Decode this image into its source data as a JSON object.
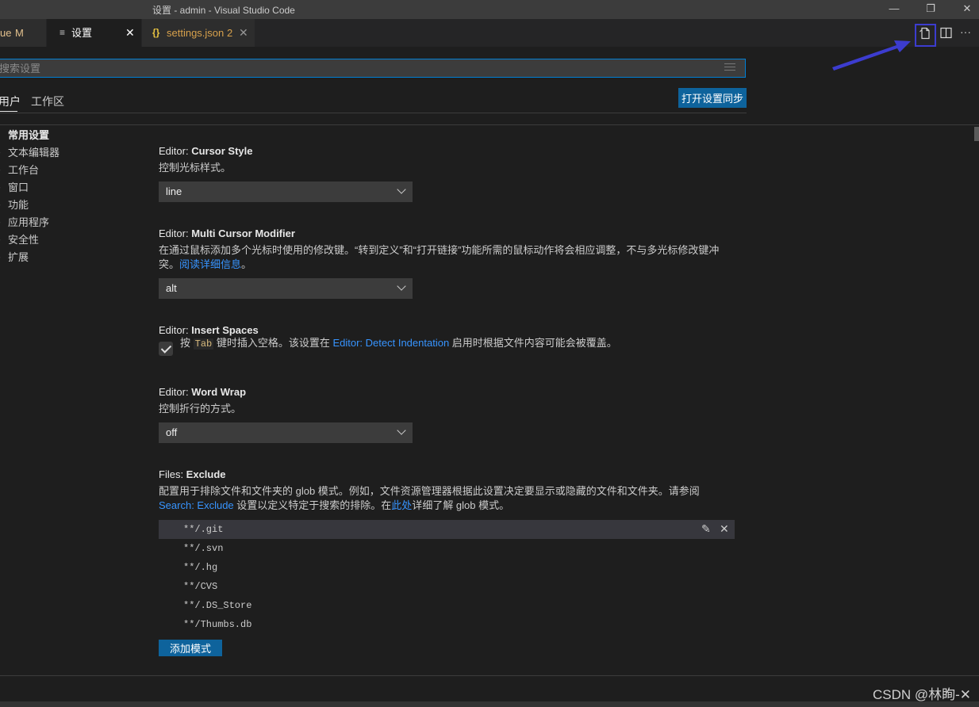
{
  "window": {
    "title": "设置 - admin - Visual Studio Code",
    "minimize_glyph": "—",
    "restore_glyph": "❐",
    "close_glyph": "✕"
  },
  "tabs": [
    {
      "label": "ue",
      "status": "M"
    },
    {
      "label": "设置",
      "icon": "≡",
      "close": "✕"
    },
    {
      "label": "settings.json",
      "icon": "{}",
      "problems": "2",
      "close": "✕"
    }
  ],
  "editor_actions": {
    "open_json_icon": "open-settings-json-icon",
    "split_icon": "split-editor-icon",
    "more_glyph": "···"
  },
  "search": {
    "placeholder": "搜索设置"
  },
  "scopes": {
    "user": "用户",
    "workspace": "工作区",
    "sync_button": "打开设置同步"
  },
  "toc": [
    {
      "label": "常用设置",
      "expandable": false
    },
    {
      "label": "文本编辑器",
      "expandable": true
    },
    {
      "label": "工作台",
      "expandable": true
    },
    {
      "label": "窗口",
      "expandable": true
    },
    {
      "label": "功能",
      "expandable": true
    },
    {
      "label": "应用程序",
      "expandable": true
    },
    {
      "label": "安全性",
      "expandable": true
    },
    {
      "label": "扩展",
      "expandable": true
    }
  ],
  "settings": {
    "cursor_style": {
      "category": "Editor: ",
      "name": "Cursor Style",
      "description": "控制光标样式。",
      "value": "line"
    },
    "multi_cursor": {
      "category": "Editor: ",
      "name": "Multi Cursor Modifier",
      "description": "在通过鼠标添加多个光标时使用的修改键。“转到定义”和“打开链接”功能所需的鼠标动作将会相应调整，不与多光标修改键冲突。",
      "link": "阅读详细信息",
      "suffix": "。",
      "value": "alt"
    },
    "insert_spaces": {
      "category": "Editor: ",
      "name": "Insert Spaces",
      "text_before": "按 ",
      "code": "Tab",
      "text_mid": " 键时插入空格。该设置在 ",
      "link": "Editor: Detect Indentation",
      "text_after": " 启用时根据文件内容可能会被覆盖。",
      "checked": true
    },
    "word_wrap": {
      "category": "Editor: ",
      "name": "Word Wrap",
      "description": "控制折行的方式。",
      "value": "off"
    },
    "files_exclude": {
      "category": "Files: ",
      "name": "Exclude",
      "desc_line1": "配置用于排除文件和文件夹的 glob 模式。例如，文件资源管理器根据此设置决定要显示或隐藏的文件和文件夹。请参阅",
      "link1": "Search: Exclude",
      "desc_mid": " 设置以定义特定于搜索的排除。在",
      "link2": "此处",
      "desc_end": "详细了解 glob 模式。",
      "patterns": [
        "**/.git",
        "**/.svn",
        "**/.hg",
        "**/CVS",
        "**/.DS_Store",
        "**/Thumbs.db"
      ],
      "add_button": "添加模式"
    }
  },
  "watermark": "CSDN @林眴-✕",
  "colors": {
    "accent": "#0e639c",
    "link": "#3794ff",
    "annotation": "#3c3ccf"
  }
}
